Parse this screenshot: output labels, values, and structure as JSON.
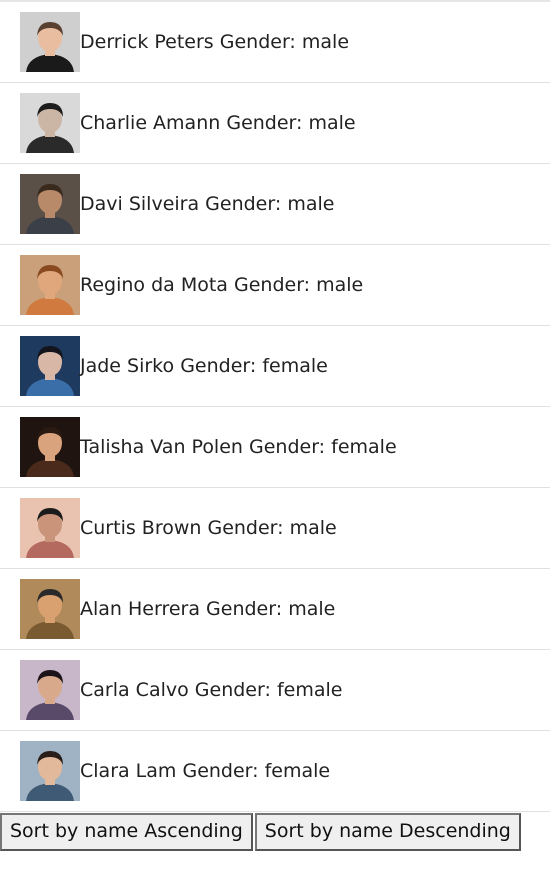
{
  "people": [
    {
      "name": "Derrick Peters",
      "gender": "male",
      "avatar": {
        "bg": "#cfcfcf",
        "skin": "#e8bda0",
        "hair": "#5a4030",
        "shirt": "#1a1a1a"
      }
    },
    {
      "name": "Charlie Amann",
      "gender": "male",
      "avatar": {
        "bg": "#d9d9d9",
        "skin": "#cbb6a6",
        "hair": "#1c1c1c",
        "shirt": "#2a2a2a"
      }
    },
    {
      "name": "Davi Silveira",
      "gender": "male",
      "avatar": {
        "bg": "#5a5048",
        "skin": "#b98a6a",
        "hair": "#3a2a1e",
        "shirt": "#3a3f48"
      }
    },
    {
      "name": "Regino da Mota",
      "gender": "male",
      "avatar": {
        "bg": "#c9a07a",
        "skin": "#e0a77c",
        "hair": "#8a4a20",
        "shirt": "#d07a40"
      }
    },
    {
      "name": "Jade Sirko",
      "gender": "female",
      "avatar": {
        "bg": "#1e3a5f",
        "skin": "#d9b7a6",
        "hair": "#14141c",
        "shirt": "#3a6ea8"
      }
    },
    {
      "name": "Talisha Van Polen",
      "gender": "female",
      "avatar": {
        "bg": "#201410",
        "skin": "#d9a37e",
        "hair": "#2a1a12",
        "shirt": "#4a2a1a"
      }
    },
    {
      "name": "Curtis Brown",
      "gender": "male",
      "avatar": {
        "bg": "#e9c3b0",
        "skin": "#c99479",
        "hair": "#1b1b1b",
        "shirt": "#b56a60"
      }
    },
    {
      "name": "Alan Herrera",
      "gender": "male",
      "avatar": {
        "bg": "#b08a5a",
        "skin": "#d9a070",
        "hair": "#2a2a2a",
        "shirt": "#7a5a30"
      }
    },
    {
      "name": "Carla Calvo",
      "gender": "female",
      "avatar": {
        "bg": "#c8b7c8",
        "skin": "#d8a98a",
        "hair": "#1c1418",
        "shirt": "#5a4a6a"
      }
    },
    {
      "name": "Clara Lam",
      "gender": "female",
      "avatar": {
        "bg": "#9fb3c4",
        "skin": "#e2b99a",
        "hair": "#2a1e18",
        "shirt": "#3f5a74"
      }
    }
  ],
  "gender_prefix": "Gender:",
  "buttons": {
    "sort_asc": "Sort by name Ascending",
    "sort_desc": "Sort by name Descending"
  }
}
